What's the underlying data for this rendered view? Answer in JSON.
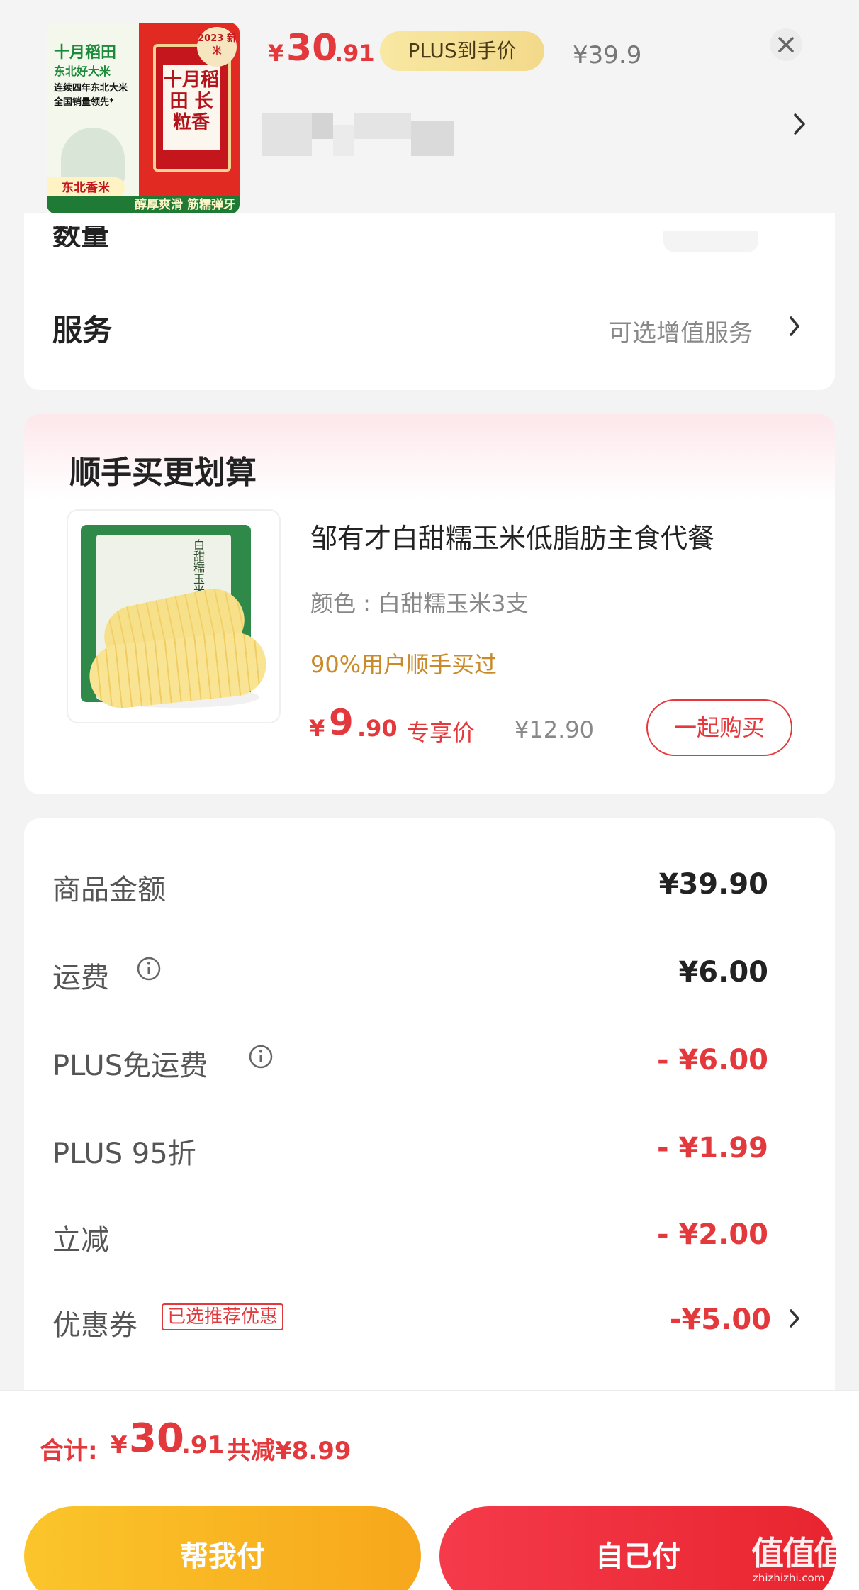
{
  "header": {
    "product_image_text": {
      "brand": "十月稻田",
      "subtitle": "东北好大米",
      "claim_1": "连续四年东北大米",
      "claim_2": "全国销量领先*",
      "new_rice": "2023 新米",
      "bag_text": "十月稻田 长粒香",
      "tag": "东北香米",
      "banner": "醇厚爽滑 筋糯弹牙"
    },
    "price_symbol": "¥",
    "price_integer": "30",
    "price_decimal": ".91",
    "plus_badge": "PLUS到手价",
    "original_price": "¥39.9",
    "close_icon": "close-icon",
    "chevron_icon": "chevron-right-icon"
  },
  "service": {
    "label": "服务",
    "value": "可选增值服务",
    "chevron_icon": "chevron-right-icon"
  },
  "bundle": {
    "title": "顺手买更划算",
    "product_name": "邹有才白甜糯玉米低脂肪主食代餐",
    "spec": "颜色 : 白甜糯玉米3支",
    "social_proof": "90%用户顺手买过",
    "price_symbol": "¥",
    "price_integer": "9",
    "price_decimal": ".90",
    "price_tag": "专享价",
    "original_price": "¥12.90",
    "buy_button": "一起购买",
    "image_text": "白甜糯玉米"
  },
  "summary": {
    "rows": [
      {
        "label": "商品金额",
        "value": "¥39.90"
      },
      {
        "label": "运费",
        "value": "¥6.00"
      },
      {
        "label": "PLUS免运费",
        "value": "- ¥6.00"
      },
      {
        "label": "PLUS 95折",
        "value": "- ¥1.99"
      },
      {
        "label": "立减",
        "value": "- ¥2.00"
      },
      {
        "label": "优惠券",
        "value": "-¥5.00"
      }
    ],
    "coupon_badge": "已选推荐优惠"
  },
  "footer": {
    "total_label": "合计:",
    "total_symbol": "¥",
    "total_integer": "30",
    "total_decimal": ".91",
    "total_saved": "共减¥8.99",
    "help_pay_button": "帮我付",
    "self_pay_button": "自己付"
  },
  "watermark": {
    "logo": "值值值",
    "url": "zhizhizhi.com"
  },
  "colors": {
    "accent_red": "#e4393c",
    "plus_gold": "#f3d98a",
    "help_pay_yellow": "#fbc52b",
    "social_proof_orange": "#c98a2a"
  }
}
